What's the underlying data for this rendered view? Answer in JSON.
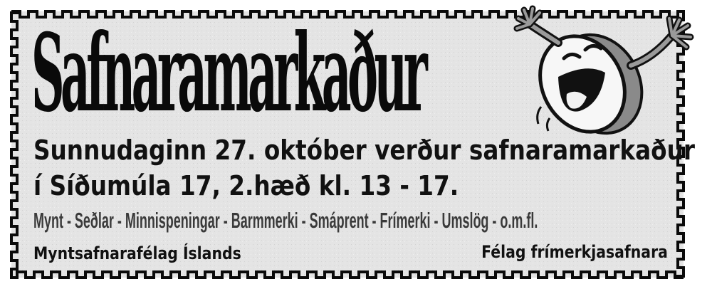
{
  "ad": {
    "title": "Safnaramarkaður",
    "line1": "Sunnudaginn 27. október verður safnaramarkaður",
    "line2": "í Síðumúla 17, 2.hæð kl. 13 - 17.",
    "items": "Mynt - Seðlar - Minnispeningar - Barmmerki - Smáprent - Frímerki - Umslög - o.m.fl.",
    "org_left": "Myntsafnarafélag Íslands",
    "org_right": "Félag frímerkjasafnara"
  },
  "colors": {
    "background": "#e6e6e6",
    "border": "#0a0a0a",
    "text": "#111111",
    "secondary_text": "#3a3a3a"
  },
  "mascot": {
    "icon": "laughing-coin-mascot-icon"
  }
}
